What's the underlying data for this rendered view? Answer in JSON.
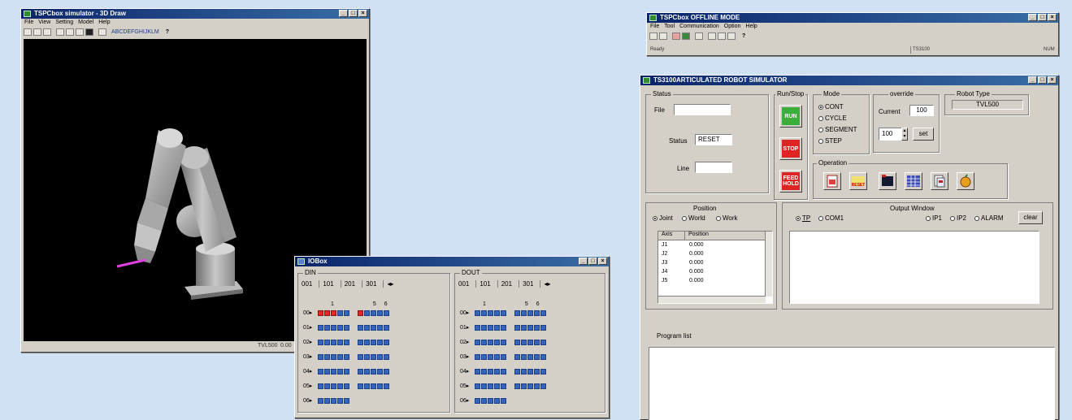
{
  "viewer": {
    "title": "TSPCbox simulator - 3D Draw",
    "menu": [
      "File",
      "View",
      "Setting",
      "Model",
      "Help"
    ],
    "toolbar_text": "ABCDEFGHIJKLM",
    "toolbar_help": "?",
    "status_model": "TVL500",
    "status_extra": "0.00"
  },
  "offline": {
    "title": "TSPCbox OFFLINE MODE",
    "menu": [
      "File",
      "Tool",
      "Communication",
      "Option",
      "Help"
    ],
    "status_ready": "Ready",
    "status_model": "TS3100",
    "status_num": "NUM"
  },
  "simulator": {
    "title": "TS3100ARTICULATED ROBOT SIMULATOR",
    "status": {
      "group": "Status",
      "file_label": "File",
      "file_value": "",
      "status_label": "Status",
      "status_value": "RESET",
      "line_label": "Line",
      "line_value": ""
    },
    "runstop": {
      "group": "Run/Stop",
      "run": "RUN",
      "stop": "STOP",
      "feedhold": "FEED HOLD"
    },
    "mode": {
      "group": "Mode",
      "options": [
        "CONT",
        "CYCLE",
        "SEGMENT",
        "STEP"
      ],
      "selected": "CONT"
    },
    "override": {
      "group": "override",
      "current_label": "Current",
      "current_value": "100",
      "input_value": "100",
      "set_label": "set"
    },
    "robot_type": {
      "group": "Robot Type",
      "value": "TVL500"
    },
    "operation": {
      "group": "Operation",
      "reset_label": "RESET",
      "icons": [
        "program-list-icon",
        "reset-icon",
        "memory-icon",
        "grid-table-icon",
        "documents-icon",
        "apple-icon"
      ]
    },
    "position": {
      "group": "Position",
      "options": [
        "Joint",
        "World",
        "Work"
      ],
      "selected": "Joint",
      "columns": [
        "Axis",
        "Position"
      ],
      "rows": [
        {
          "axis": "J1",
          "pos": "0.000"
        },
        {
          "axis": "J2",
          "pos": "0.000"
        },
        {
          "axis": "J3",
          "pos": "0.000"
        },
        {
          "axis": "J4",
          "pos": "0.000"
        },
        {
          "axis": "J5",
          "pos": "0.000"
        }
      ]
    },
    "output": {
      "group": "Output Window",
      "options": [
        "TP",
        "COM1",
        "IP1",
        "IP2",
        "ALARM"
      ],
      "selected": "TP",
      "clear": "clear"
    },
    "program_list": {
      "label": "Program list"
    }
  },
  "iobox": {
    "title": "IOBox",
    "din": {
      "label": "DIN",
      "tabs": [
        "001",
        "101",
        "201",
        "301"
      ],
      "col_markers": [
        "1",
        "5",
        "6"
      ],
      "rows": [
        "00▸",
        "01▸",
        "02▸",
        "03▸",
        "04▸",
        "05▸",
        "06▸"
      ]
    },
    "dout": {
      "label": "DOUT",
      "tabs": [
        "001",
        "101",
        "201",
        "301"
      ],
      "col_markers": [
        "1",
        "5",
        "6"
      ],
      "rows": [
        "00▸",
        "01▸",
        "02▸",
        "03▸",
        "04▸",
        "05▸",
        "06▸"
      ]
    }
  }
}
